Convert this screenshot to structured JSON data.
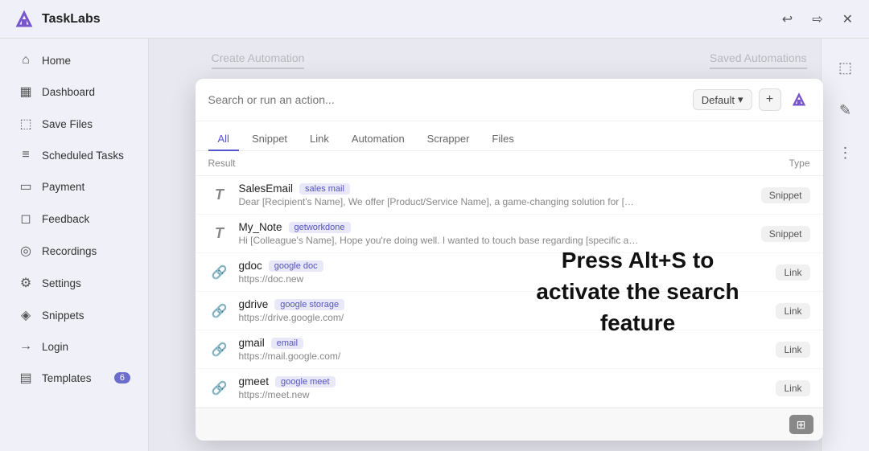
{
  "titleBar": {
    "appName": "TaskLabs",
    "backBtn": "↩",
    "forwardBtn": "⇨",
    "closeBtn": "✕"
  },
  "sidebar": {
    "items": [
      {
        "id": "home",
        "label": "Home",
        "icon": "⌂",
        "active": false
      },
      {
        "id": "dashboard",
        "label": "Dashboard",
        "icon": "▦",
        "active": false
      },
      {
        "id": "save-files",
        "label": "Save Files",
        "icon": "⬚",
        "active": false
      },
      {
        "id": "scheduled-tasks",
        "label": "Scheduled Tasks",
        "icon": "≡",
        "active": false
      },
      {
        "id": "payment",
        "label": "Payment",
        "icon": "▭",
        "active": false
      },
      {
        "id": "feedback",
        "label": "Feedback",
        "icon": "◻",
        "active": false
      },
      {
        "id": "recordings",
        "label": "Recordings",
        "icon": "◎",
        "active": false
      },
      {
        "id": "settings",
        "label": "Settings",
        "icon": "⚙",
        "active": false
      },
      {
        "id": "snippets",
        "label": "Snippets",
        "icon": "◈",
        "active": false
      },
      {
        "id": "login",
        "label": "Login",
        "icon": "→",
        "active": false
      },
      {
        "id": "templates",
        "label": "Templates",
        "icon": "▤",
        "badge": "6",
        "active": false
      }
    ]
  },
  "bgHeader": {
    "create": "Create Automation",
    "saved": "Saved Automations"
  },
  "modal": {
    "searchPlaceholder": "Search or run an action...",
    "defaultLabel": "Default",
    "tabs": [
      {
        "id": "all",
        "label": "All",
        "active": true
      },
      {
        "id": "snippet",
        "label": "Snippet",
        "active": false
      },
      {
        "id": "link",
        "label": "Link",
        "active": false
      },
      {
        "id": "automation",
        "label": "Automation",
        "active": false
      },
      {
        "id": "scrapper",
        "label": "Scrapper",
        "active": false
      },
      {
        "id": "files",
        "label": "Files",
        "active": false
      }
    ],
    "tableHeader": {
      "result": "Result",
      "type": "Type"
    },
    "results": [
      {
        "icon": "T",
        "iconType": "text",
        "name": "SalesEmail",
        "tag": "sales mail",
        "sub": "Dear [Recipient's Name], We offer [Product/Service Name], a game-changing solution for [Recipient's Ind...",
        "badge": "Snippet"
      },
      {
        "icon": "T",
        "iconType": "text",
        "name": "My_Note",
        "tag": "getworkdone",
        "sub": "Hi [Colleague's Name], Hope you're doing well. I wanted to touch base regarding [specific assignment/pr...",
        "badge": "Snippet"
      },
      {
        "icon": "🔗",
        "iconType": "link",
        "name": "gdoc",
        "tag": "google doc",
        "sub": "https://doc.new",
        "badge": "Link"
      },
      {
        "icon": "🔗",
        "iconType": "link",
        "name": "gdrive",
        "tag": "google storage",
        "sub": "https://drive.google.com/",
        "badge": "Link"
      },
      {
        "icon": "🔗",
        "iconType": "link",
        "name": "gmail",
        "tag": "email",
        "sub": "https://mail.google.com/",
        "badge": "Link"
      },
      {
        "icon": "🔗",
        "iconType": "link",
        "name": "gmeet",
        "tag": "google meet",
        "sub": "https://meet.new",
        "badge": "Link"
      }
    ],
    "overlayText": "Press Alt+S to activate the search feature",
    "footerBtn": "⊞"
  },
  "rightPanel": {
    "icons": [
      "⬚",
      "✎",
      "⋮"
    ]
  }
}
